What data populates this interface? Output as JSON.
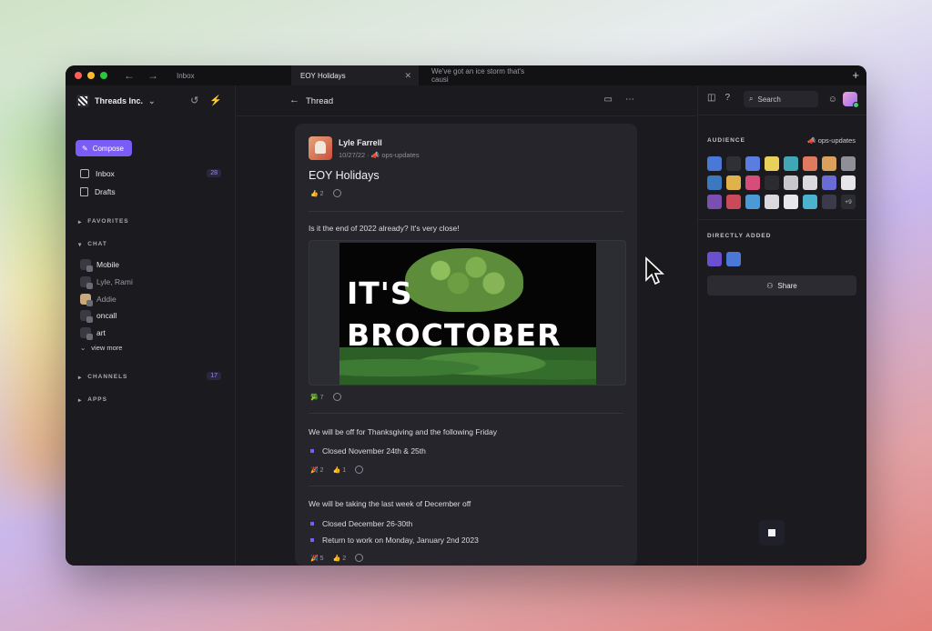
{
  "tabs": [
    {
      "label": "Inbox"
    },
    {
      "label": "EOY Holidays"
    },
    {
      "label": "We've got an ice storm that's causi"
    }
  ],
  "colors": {
    "accent": "#7c5cf6",
    "close": "#ff5f57",
    "minimize": "#febc2e",
    "zoom": "#28c840"
  },
  "sidebar": {
    "org": "Threads Inc.",
    "compose": "Compose",
    "nav": [
      {
        "label": "Inbox",
        "count": "28",
        "icon": "inbox-icon"
      },
      {
        "label": "Drafts",
        "icon": "document-icon"
      }
    ],
    "sections": {
      "favorites": "FAVORITES",
      "chat": "CHAT",
      "channels": "CHANNELS",
      "channels_count": "17",
      "apps": "APPS"
    },
    "chats": [
      {
        "label": "Mobile"
      },
      {
        "label": "Lyle, Rami"
      },
      {
        "label": "Addie"
      },
      {
        "label": "oncall"
      },
      {
        "label": "art"
      }
    ],
    "view_more": "view more"
  },
  "thread": {
    "header": "Thread",
    "author": "Lyle Farrell",
    "date": "10/27/22",
    "channel": "ops-updates",
    "title": "EOY Holidays",
    "title_reaction": "2",
    "p1": "Is it the end of 2022 already? It's very close!",
    "gif_line1": "IT'S",
    "gif_line2": "BROCTOBER",
    "gif_reaction": "7",
    "p2": "We will be off for Thanksgiving and the following Friday",
    "p2_bullet": "Closed November 24th & 25th",
    "p2_reaction1": "2",
    "p2_reaction2": "1",
    "p3": "We will be taking the last week of December off",
    "p3_bullets": [
      "Closed December 26-30th",
      "Return to work on Monday, January 2nd 2023"
    ],
    "p3_reaction1": "5",
    "p3_reaction2": "2"
  },
  "right": {
    "search": "Search",
    "audience": "AUDIENCE",
    "channel": "ops-updates",
    "more": "+9",
    "directly_added": "DIRECTLY ADDED",
    "share": "Share",
    "avatar_colors": [
      "#4a78d6",
      "#2f2f36",
      "#5a7ee0",
      "#e8d05a",
      "#3fa7b6",
      "#e07a5f",
      "#d9a15b",
      "#8f8f97",
      "#3a78c0",
      "#e0b24a",
      "#d64d7a",
      "#2b2b30",
      "#c7c7cc",
      "#d9d9de",
      "#6b6bd6",
      "#e6e6ea",
      "#7b4fb0",
      "#c94a58",
      "#4a9ad6",
      "#dadade",
      "#e8e8ec",
      "#4bb3d0",
      "#3a3a4a"
    ]
  }
}
